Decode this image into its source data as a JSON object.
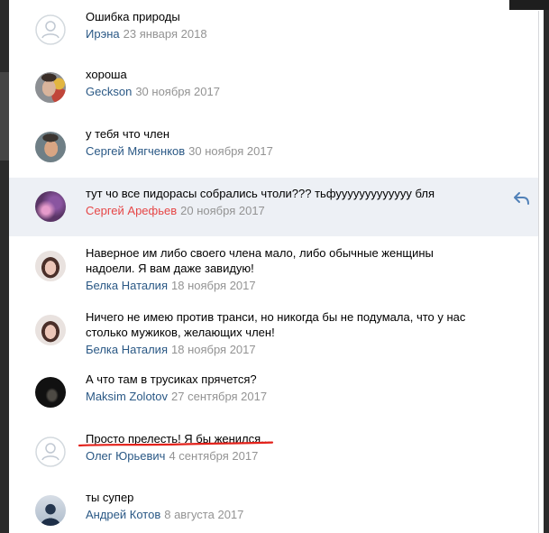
{
  "comments": [
    {
      "lines": [
        "Ошибка природы"
      ],
      "author": "Ирэна",
      "date": "23 января 2018",
      "avatar_icon": "person-placeholder-icon"
    },
    {
      "lines": [
        "хороша"
      ],
      "author": "Geckson",
      "date": "30 ноября 2017"
    },
    {
      "lines": [
        "у тебя что член"
      ],
      "author": "Сергей Мягченков",
      "date": "30 ноября 2017"
    },
    {
      "lines": [
        "тут чо все пидорасы собрались чтоли??? тьфууууууууууууу бля"
      ],
      "author": "Сергей Арефьев",
      "date": "20 ноября 2017",
      "highlighted": true
    },
    {
      "lines": [
        "Наверное им либо своего члена мало, либо обычные женщины",
        "надоели. Я вам даже завидую!"
      ],
      "author": "Белка Наталия",
      "date": "18 ноября 2017"
    },
    {
      "lines": [
        "Ничего не имею против транси, но никогда бы не подумала, что у нас",
        "столько мужиков, желающих член!"
      ],
      "author": "Белка Наталия",
      "date": "18 ноября 2017"
    },
    {
      "lines": [
        "А что там в трусиках прячется?"
      ],
      "author": "Maksim Zolotov",
      "date": "27 сентября 2017"
    },
    {
      "lines": [
        "Просто прелесть! Я бы женился..."
      ],
      "author": "Олег Юрьевич",
      "date": "4 сентября 2017",
      "avatar_icon": "person-placeholder-icon"
    },
    {
      "lines": [
        "ты супер"
      ],
      "author": "Андрей Котов",
      "date": "8 августа 2017"
    }
  ],
  "icons": {
    "reply": "reply-icon",
    "placeholder_avatar": "person-placeholder-icon"
  },
  "theme": {
    "link_color": "#2a5885",
    "date_color": "#939393",
    "text_color": "#000000",
    "highlight_author_color": "#e64646",
    "highlight_bg": "#edf0f5",
    "underline_color": "#e3221b",
    "reply_icon_color": "#5181b8"
  }
}
